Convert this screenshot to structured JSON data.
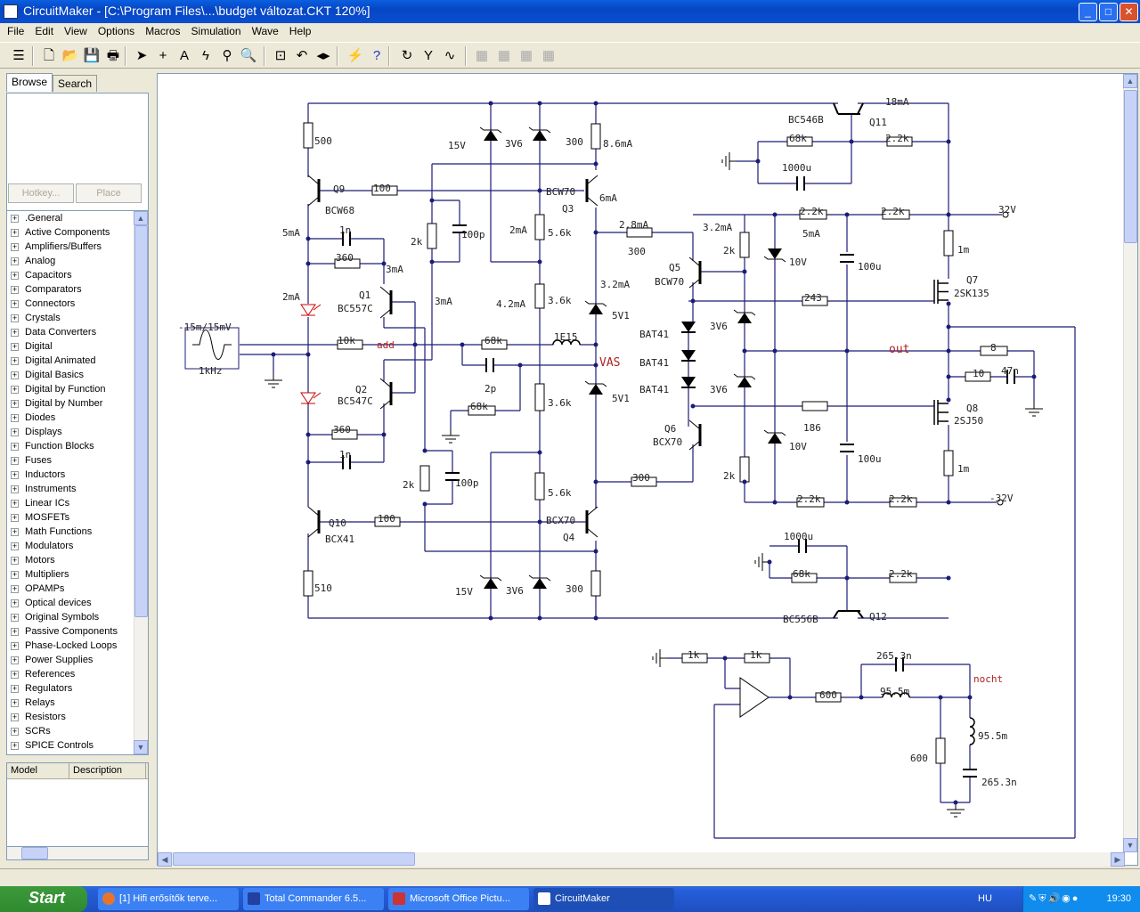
{
  "window": {
    "title": "CircuitMaker - [C:\\Program Files\\...\\budget változat.CKT 120%]",
    "minimize": "_",
    "maximize": "□",
    "close": "✕"
  },
  "menu": [
    "File",
    "Edit",
    "View",
    "Options",
    "Macros",
    "Simulation",
    "Wave",
    "Help"
  ],
  "toolbar_icons": [
    "parts-icon",
    "new-icon",
    "open-icon",
    "save-icon",
    "print-icon",
    "arrow-icon",
    "wire-icon",
    "text-icon",
    "probe-icon",
    "probe2-icon",
    "zoom-icon",
    "fit-icon",
    "rotate-icon",
    "mirror-icon",
    "simulate-icon",
    "help-icon",
    "reset-icon",
    "tool-icon",
    "wave-icon",
    "layout1-icon",
    "layout2-icon",
    "layout3-icon",
    "layout4-icon"
  ],
  "left_panel": {
    "tabs": [
      "Browse",
      "Search"
    ],
    "hotkey": "Hotkey...",
    "place": "Place",
    "library": [
      ".General",
      "Active Components",
      "Amplifiers/Buffers",
      "Analog",
      "Capacitors",
      "Comparators",
      "Connectors",
      "Crystals",
      "Data Converters",
      "Digital",
      "Digital Animated",
      "Digital Basics",
      "Digital by Function",
      "Digital by Number",
      "Diodes",
      "Displays",
      "Function Blocks",
      "Fuses",
      "Inductors",
      "Instruments",
      "Linear ICs",
      "MOSFETs",
      "Math Functions",
      "Modulators",
      "Motors",
      "Multipliers",
      "OPAMPs",
      "Optical devices",
      "Original Symbols",
      "Passive Components",
      "Phase-Locked Loops",
      "Power Supplies",
      "References",
      "Regulators",
      "Relays",
      "Resistors",
      "SCRs",
      "SPICE Controls"
    ],
    "model_columns": [
      "Model",
      "Description"
    ]
  },
  "schematic": {
    "wire_color": "#1c1c78",
    "net_label_color": "#b02020",
    "labels": [
      "500",
      "15V",
      "3V6",
      "300",
      "8.6mA",
      "BC546B",
      "Q11",
      "18mA",
      "68k",
      "2.2k",
      "1000u",
      "Q9",
      "100",
      "BCW68",
      "BCW70",
      "6mA",
      "Q3",
      "5mA",
      "1n",
      "2k",
      "100p",
      "2mA",
      "5.6k",
      "2.8mA",
      "300",
      "3.2mA",
      "2.2k",
      "2.2k",
      "32V",
      "5mA",
      "360",
      "3mA",
      "2k",
      "10V",
      "100u",
      "1m",
      "2mA",
      "3mA",
      "4.2mA",
      "3.6k",
      "3.2mA",
      "Q5",
      "BCW70",
      "Q7",
      "2SK135",
      "Q1",
      "BC557C",
      "5V1",
      "243",
      "-15m/15mV",
      "BAT41",
      "3V6",
      "10k",
      "68k",
      "1E15",
      "8",
      "1kHz",
      "BAT41",
      "10",
      "47n",
      "2p",
      "Q2",
      "BC547C",
      "3.6k",
      "5V1",
      "BAT41",
      "3V6",
      "68k",
      "186",
      "Q8",
      "2SJ50",
      "Q6",
      "BCX70",
      "10V",
      "100u",
      "360",
      "1n",
      "2k",
      "100p",
      "1m",
      "2k",
      "5.6k",
      "300",
      "2.2k",
      "2.2k",
      "-32V",
      "Q10",
      "100",
      "BCX70",
      "BCX41",
      "Q4",
      "1000u",
      "510",
      "15V",
      "3V6",
      "300",
      "68k",
      "2.2k",
      "BC556B",
      "Q12",
      "1k",
      "1k",
      "265.3n",
      "95.5m",
      "600",
      "95.5m",
      "600",
      "265.3n"
    ],
    "net_labels": [
      "add",
      "VAS",
      "out",
      "nocht"
    ]
  },
  "taskbar": {
    "start": "Start",
    "tasks": [
      "[1] Hifi erősítők terve...",
      "Total Commander 6.5...",
      "Microsoft Office Pictu...",
      "CircuitMaker"
    ],
    "language": "HU",
    "clock": "19:30"
  }
}
